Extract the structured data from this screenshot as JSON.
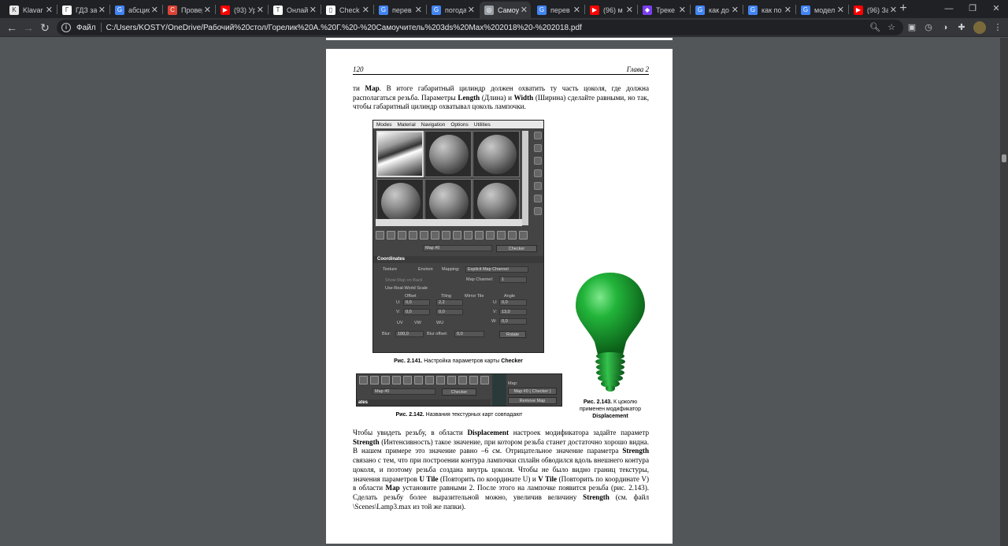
{
  "tabs": [
    {
      "label": "Klavar",
      "fav": "#e8e8e8",
      "favtxt": "K"
    },
    {
      "label": "ГДЗ за",
      "fav": "#ffffff",
      "favtxt": "Г"
    },
    {
      "label": "абсцис",
      "fav": "#4285f4",
      "favtxt": "G"
    },
    {
      "label": "Провер",
      "fav": "#db4437",
      "favtxt": "C"
    },
    {
      "label": "(93) Ур",
      "fav": "#ff0000",
      "favtxt": "▶"
    },
    {
      "label": "Онлай",
      "fav": "#ffffff",
      "favtxt": "T"
    },
    {
      "label": "Check",
      "fav": "#ffffff",
      "favtxt": "▯"
    },
    {
      "label": "перев",
      "fav": "#4285f4",
      "favtxt": "G"
    },
    {
      "label": "погода",
      "fav": "#4285f4",
      "favtxt": "G"
    },
    {
      "label": "Самоу",
      "fav": "#9aa0a6",
      "favtxt": "◎",
      "active": true
    },
    {
      "label": "перев",
      "fav": "#4285f4",
      "favtxt": "G"
    },
    {
      "label": "(96) м",
      "fav": "#ff0000",
      "favtxt": "▶"
    },
    {
      "label": "Треке",
      "fav": "#7b3ff2",
      "favtxt": "◆"
    },
    {
      "label": "как до",
      "fav": "#4285f4",
      "favtxt": "G"
    },
    {
      "label": "как по",
      "fav": "#4285f4",
      "favtxt": "G"
    },
    {
      "label": "модел",
      "fav": "#4285f4",
      "favtxt": "G"
    },
    {
      "label": "(96) За",
      "fav": "#ff0000",
      "favtxt": "▶"
    }
  ],
  "toolbar": {
    "file_label": "Файл",
    "url": "C:/Users/KOSTY/OneDrive/Рабочий%20стол/Горелик%20А.%20Г.%20-%20Самоучитель%203ds%20Max%202018%20-%202018.pdf"
  },
  "page": {
    "number": "120",
    "chapter": "Глава 2",
    "p1": "ти <b>Map</b>. В итоге габаритный цилиндр должен охватить ту часть цоколя, где должна располагаться резьба. Параметры <b>Length</b> (Длина) и <b>Width</b> (Ширина) сделайте равными, но так, чтобы габаритный цилиндр охватывал цоколь лампочки.",
    "cap141": "<b>Рис. 2.141.</b> Настройка параметров карты <b>Checker</b>",
    "cap142": "<b>Рис. 2.142.</b> Названия текстурных карт совпадают",
    "cap143": "<b>Рис. 2.143.</b> К цоколю применен модификатор <b>Displacement</b>",
    "p2": "Чтобы увидеть резьбу, в области <b>Displacement</b> настроек модификатора задайте пара­метр <b>Strength</b> (Интенсивность) такое значение, при котором резьба станет достаточно хорошо видна. В нашем примере это значение равно –6 см. Отрицательное значение параметра <b>Strength</b> связано с тем, что при построении контура лампочки сплайн обво­дился вдоль внешнего контура цоколя, и поэтому резьба создана внутрь цоколя. Чтобы не было видно границ текстуры, значения параметров <b>U Tile</b> (Повторить по координа­те U) и <b>V Tile</b> (Повторить по координате V) в области <b>Map</b> установите равными 2. По­сле этого на лампочке появится резьба (рис. 2.143). Сделать резьбу более выразитель­ной можно, увеличив величину <b>Strength</b> (см. файл \\Scenes\\Lamp3.max из той же папки)."
  },
  "editor": {
    "menu": [
      "Modes",
      "Material",
      "Navigation",
      "Options",
      "Utilities"
    ],
    "map_name": "Map #0",
    "map_type": "Checker",
    "rollout": "Coordinates",
    "texture": "Texture",
    "environ": "Environ",
    "mapping_label": "Mapping:",
    "mapping_value": "Explicit Map Channel",
    "show_map_on_back": "Show Map on Back",
    "map_channel_label": "Map Channel:",
    "map_channel_value": "1",
    "use_real_world": "Use Real-World Scale",
    "offset": "Offset",
    "tiling": "Tiling",
    "mirror_tile": "Mirror Tile",
    "angle": "Angle",
    "u_label": "U:",
    "v_label": "V:",
    "w_label": "W:",
    "u_offset": "0,0",
    "v_offset": "0,0",
    "u_tiling": "2,2",
    "v_tiling": "0,0",
    "u_angle": "0,0",
    "v_angle": "13,0",
    "w_angle": "0,0",
    "uv": "UV",
    "vw": "VW",
    "wu": "WU",
    "blur_label": "Blur:",
    "blur_value": "100,0",
    "blur_offset_label": "Blur offset:",
    "blur_offset_value": "0,0",
    "rotate": "Rotate"
  },
  "strip": {
    "map_name": "Map #0",
    "map_type": "Checker",
    "map_label": "Map:",
    "map_slot": "Map #0  ( Checker )",
    "remove_map": "Remove Map",
    "ates": "ates"
  }
}
